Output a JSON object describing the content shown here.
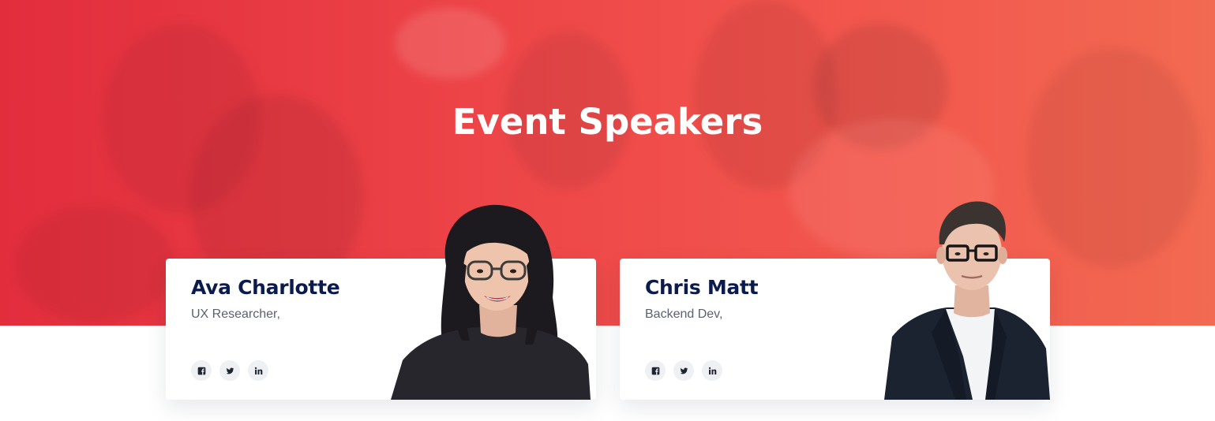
{
  "hero": {
    "title": "Event Speakers"
  },
  "speakers": [
    {
      "name": "Ava Charlotte",
      "role": "UX Researcher,",
      "socials": [
        "facebook-icon",
        "twitter-icon",
        "linkedin-icon"
      ]
    },
    {
      "name": "Chris Matt",
      "role": "Backend Dev,",
      "socials": [
        "facebook-icon",
        "twitter-icon",
        "linkedin-icon"
      ]
    }
  ],
  "colors": {
    "hero_gradient_start": "#e0303e",
    "hero_gradient_end": "#f16a50",
    "name_color": "#0c1b4d",
    "role_color": "#5b6170",
    "social_bg": "#eef0f3"
  }
}
